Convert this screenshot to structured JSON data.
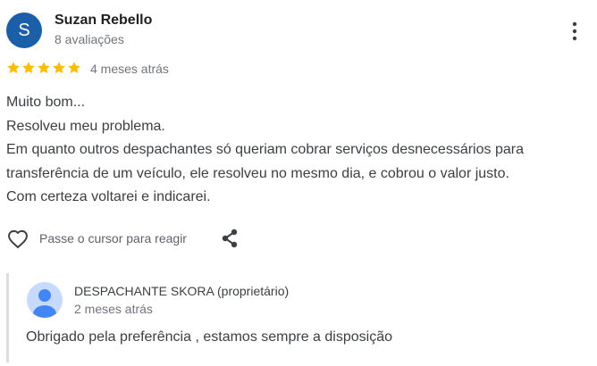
{
  "reviewer": {
    "initial": "S",
    "name": "Suzan Rebello",
    "review_count": "8 avaliações",
    "avatar_color": "#1a5fa8"
  },
  "rating": {
    "stars": 5,
    "max": 5,
    "star_color": "#fbbc04"
  },
  "time_ago": "4 meses atrás",
  "review_lines": [
    "Muito bom...",
    "Resolveu meu problema.",
    "Em quanto outros despachantes só queriam cobrar serviços desnecessários para",
    "transferência de um veículo, ele resolveu no mesmo dia, e cobrou o valor justo.",
    "Com certeza voltarei e indicarei."
  ],
  "actions": {
    "react_label": "Passe o cursor para reagir",
    "heart_icon": "heart-outline-icon",
    "share_icon": "share-icon",
    "more_icon": "more-vert-icon"
  },
  "owner_reply": {
    "name": "DESPACHANTE SKORA (proprietário)",
    "time_ago": "2 meses atrás",
    "text": "Obrigado pela preferência , estamos sempre a disposição",
    "avatar_icon": "default-profile-icon"
  }
}
